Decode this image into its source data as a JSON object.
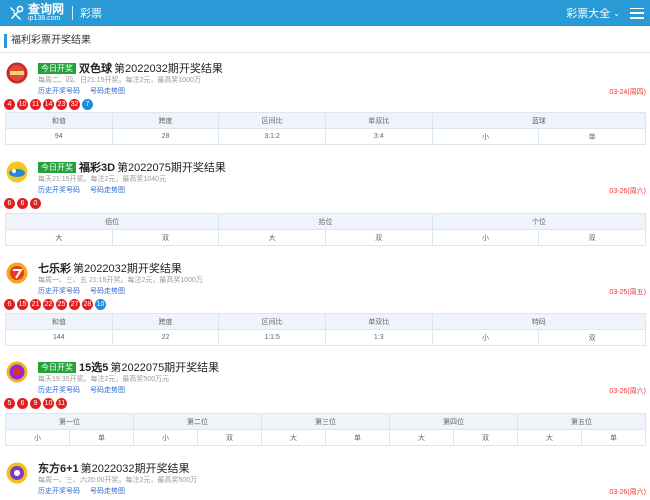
{
  "header": {
    "logo_name": "查询网",
    "logo_domain": "ip138.com",
    "section": "彩票",
    "category_menu": "彩票大全"
  },
  "page_heading": "福利彩票开奖结果",
  "lotteries": [
    {
      "badge": "今日开奖",
      "name": "双色球",
      "issue": "第2022032期开奖结果",
      "schedule": "每周二、四、日21:15开奖。每注2元，最高奖1000万",
      "link_history": "历史开奖号码",
      "link_trend": "号码走势图",
      "date": "03-24(周四)",
      "balls_red": [
        "4",
        "10",
        "11",
        "14",
        "23",
        "32"
      ],
      "balls_blue": [
        "7"
      ],
      "stat_headers": [
        "和值",
        "跨度",
        "区间比",
        "单双比",
        "蓝球"
      ],
      "stat_values": [
        "94",
        "28",
        "3:1:2",
        "3:4",
        "小",
        "单"
      ]
    },
    {
      "badge": "今日开奖",
      "name": "福彩3D",
      "issue": "第2022075期开奖结果",
      "schedule": "每天21:15开奖。每注2元，最高奖1040元",
      "link_history": "历史开奖号码",
      "link_trend": "号码走势图",
      "date": "03-26(周六)",
      "balls_red": [
        "6",
        "6",
        "0"
      ],
      "stat_headers": [
        "佰位",
        "拾位",
        "个位"
      ],
      "stat_values": [
        "大",
        "双",
        "大",
        "双",
        "小",
        "双"
      ]
    },
    {
      "name": "七乐彩",
      "issue": "第2022032期开奖结果",
      "schedule": "每周一、三、五 21:15开奖。每注2元，最高奖1000万",
      "link_history": "历史开奖号码",
      "link_trend": "号码走势图",
      "date": "03-25(周五)",
      "balls_red": [
        "6",
        "15",
        "21",
        "22",
        "25",
        "27",
        "28"
      ],
      "balls_blue": [
        "10"
      ],
      "stat_headers": [
        "和值",
        "跨度",
        "区间比",
        "单双比",
        "特码"
      ],
      "stat_values": [
        "144",
        "22",
        "1:1:5",
        "1:3",
        "小",
        "双"
      ]
    },
    {
      "badge": "今日开奖",
      "name": "15选5",
      "issue": "第2022075期开奖结果",
      "schedule": "每天19:35开奖。每注2元，最高奖500万元",
      "link_history": "历史开奖号码",
      "link_trend": "号码走势图",
      "date": "03-26(周六)",
      "balls_red": [
        "5",
        "6",
        "9",
        "10",
        "11"
      ],
      "stat_headers": [
        "第一位",
        "第二位",
        "第三位",
        "第四位",
        "第五位"
      ],
      "stat_values": [
        "小",
        "单",
        "小",
        "双",
        "大",
        "单",
        "大",
        "双",
        "大",
        "单"
      ]
    },
    {
      "name": "东方6+1",
      "issue": "第2022032期开奖结果",
      "schedule": "每周一、三、六20:00开奖。每注2元，最高奖500万",
      "link_history": "历史开奖号码",
      "link_trend": "号码走势图",
      "date": "03-26(周六)"
    }
  ],
  "colors": {
    "header_bg": "#2a9ad6",
    "badge_green": "#22a33a",
    "ball_red": "#e02020",
    "ball_blue": "#1f8dd6",
    "date_red": "#e33333",
    "link_blue": "#2a6ad6"
  }
}
